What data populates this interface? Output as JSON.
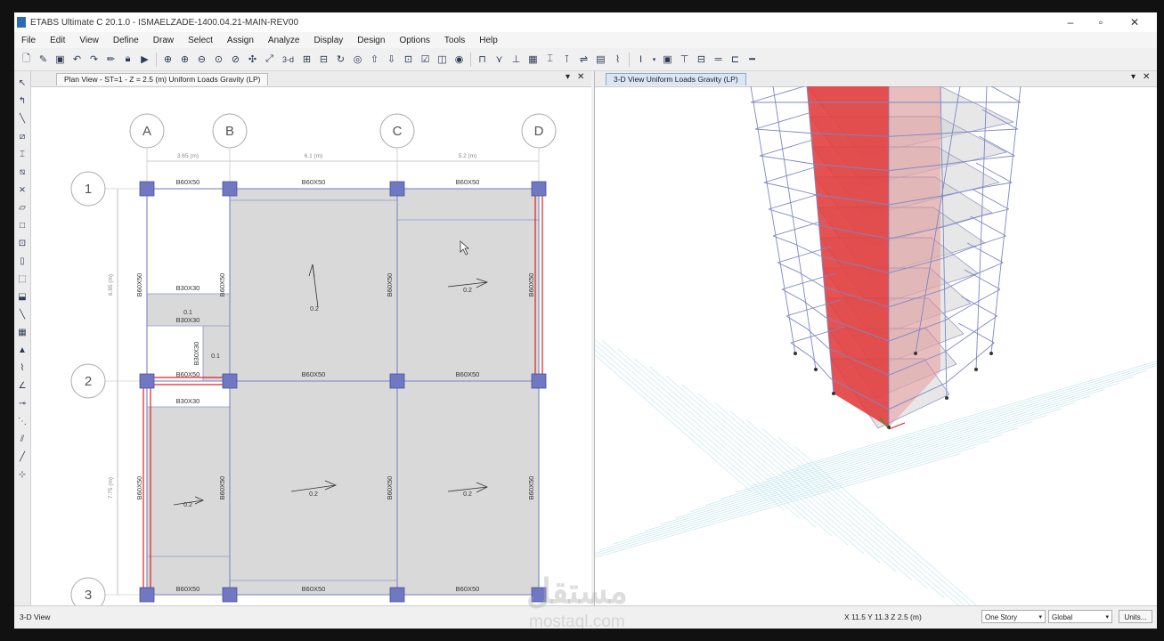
{
  "window": {
    "title": "ETABS Ultimate C 20.1.0 - ISMAELZADE-1400.04.21-MAIN-REV00",
    "controls": {
      "minimize": "–",
      "maximize": "▫",
      "close": "✕"
    }
  },
  "menu": [
    "File",
    "Edit",
    "View",
    "Define",
    "Draw",
    "Select",
    "Assign",
    "Analyze",
    "Display",
    "Design",
    "Options",
    "Tools",
    "Help"
  ],
  "toolbar": {
    "text_buttons": [
      "3-d",
      "I",
      "▾"
    ]
  },
  "plan_view": {
    "tab_title": "Plan View - ST=1 - Z = 2.5 (m)  Uniform Loads Gravity  (LP)",
    "grid_columns": [
      "A",
      "B",
      "C",
      "D"
    ],
    "grid_rows": [
      "1",
      "2",
      "3"
    ],
    "dims_x": [
      "3.65 (m)",
      "6.1 (m)",
      "5.2 (m)"
    ],
    "dims_y": [
      "6.95 (m)",
      "7.75 (m)"
    ],
    "beam_top": [
      "B60X50",
      "B60X50",
      "B60X50"
    ],
    "beam_mid": [
      "B60X50",
      "B60X50",
      "B60X50"
    ],
    "beam_bot": [
      "B60X50",
      "B60X50",
      "B60X50"
    ],
    "beam_vertical": [
      "B60X50",
      "B60X50",
      "B60X50",
      "B60X50",
      "B60X50",
      "B60X50",
      "B60X50",
      "B60X50"
    ],
    "beam_secondary": [
      "B30X30",
      "B30X30",
      "B30X30",
      "B30X30"
    ],
    "loads": [
      "0.2",
      "0.2",
      "0.2",
      "0.2",
      "0.2",
      "0.1",
      "0.1"
    ],
    "pane_close": "✕",
    "pane_menu": "▾"
  },
  "view_3d": {
    "tab_title": "3-D View  Uniform Loads Gravity  (LP)",
    "pane_close": "✕",
    "pane_menu": "▾"
  },
  "status": {
    "left": "3-D View",
    "coords": "X 11.5  Y 11.3  Z 2.5 (m)",
    "story_select": "One Story",
    "coord_select": "Global",
    "units_button": "Units..."
  },
  "watermark": {
    "main": "مستقل",
    "sub": "mostaql.com"
  },
  "colors": {
    "slab": "#d9d9d9",
    "column": "#6f78c0",
    "beam_line": "#8a95c9",
    "wall_red": "#e02020",
    "accent": "#2a6db5"
  }
}
